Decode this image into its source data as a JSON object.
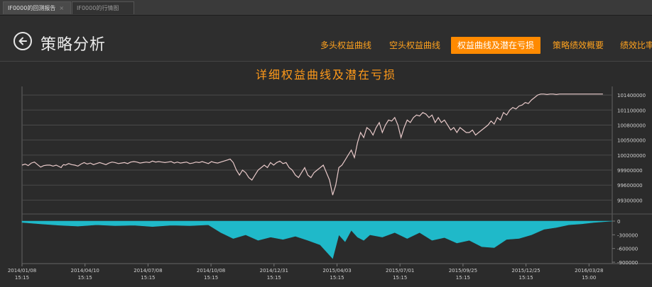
{
  "tabs": [
    {
      "label": "IF0000的回测报告",
      "active": true,
      "close": "×"
    },
    {
      "label": "IF0000的行情图",
      "active": false
    }
  ],
  "header": {
    "back_icon": "arrow-left-icon",
    "title": "策略分析",
    "nav": [
      {
        "label": "多头权益曲线",
        "active": false
      },
      {
        "label": "空头权益曲线",
        "active": false
      },
      {
        "label": "权益曲线及潜在亏损",
        "active": true
      },
      {
        "label": "策略绩效概要",
        "active": false
      },
      {
        "label": "绩效比率",
        "active": false
      }
    ]
  },
  "colors": {
    "accent": "#ff8a00",
    "line": "#e8c9c9",
    "drawdown": "#1fb9c9",
    "background": "#2b2b2b"
  },
  "chart_data": {
    "type": "area",
    "title": "详细权益曲线及潜在亏损",
    "x_ticks": [
      {
        "date": "2014/01/08",
        "time": "15:15"
      },
      {
        "date": "2014/04/10",
        "time": "15:15"
      },
      {
        "date": "2014/07/08",
        "time": "15:15"
      },
      {
        "date": "2014/10/08",
        "time": "15:15"
      },
      {
        "date": "2014/12/31",
        "time": "15:15"
      },
      {
        "date": "2015/04/03",
        "time": "15:15"
      },
      {
        "date": "2015/07/01",
        "time": "15:15"
      },
      {
        "date": "2015/09/25",
        "time": "15:15"
      },
      {
        "date": "2015/12/25",
        "time": "15:15"
      },
      {
        "date": "2016/03/28",
        "time": "15:00"
      }
    ],
    "equity": {
      "name": "权益",
      "y_ticks": [
        101400000,
        101100000,
        100800000,
        100500000,
        100200000,
        99900000,
        99600000,
        99300000
      ],
      "ylim": [
        99150000,
        101500000
      ],
      "x": [
        0,
        0.05,
        0.1,
        0.15,
        0.2,
        0.25,
        0.3,
        0.35,
        0.4,
        0.45,
        0.5,
        0.55,
        0.6,
        0.63,
        0.65,
        0.67,
        0.7,
        0.75,
        0.8,
        0.85,
        0.9,
        0.95,
        1.0,
        1.05,
        1.1,
        1.15,
        1.2,
        1.25,
        1.3,
        1.35,
        1.4,
        1.45,
        1.5,
        1.55,
        1.6,
        1.65,
        1.7,
        1.75,
        1.8,
        1.85,
        1.9,
        1.95,
        2.0,
        2.05,
        2.1,
        2.15,
        2.2,
        2.25,
        2.3,
        2.35,
        2.4,
        2.45,
        2.5,
        2.55,
        2.6,
        2.65,
        2.7,
        2.75,
        2.8,
        2.85,
        2.9,
        2.95,
        3.0,
        3.05,
        3.1,
        3.15,
        3.2,
        3.25,
        3.3,
        3.35,
        3.4,
        3.45,
        3.5,
        3.55,
        3.6,
        3.65,
        3.7,
        3.75,
        3.8,
        3.85,
        3.9,
        3.95,
        4.0,
        4.05,
        4.1,
        4.15,
        4.2,
        4.25,
        4.3,
        4.35,
        4.4,
        4.45,
        4.5,
        4.55,
        4.6,
        4.65,
        4.7,
        4.75,
        4.8,
        4.85,
        4.9,
        4.95,
        5.0,
        5.05,
        5.1,
        5.15,
        5.2,
        5.25,
        5.3,
        5.35,
        5.4,
        5.45,
        5.5,
        5.55,
        5.6,
        5.65,
        5.7,
        5.75,
        5.8,
        5.85,
        5.9,
        5.95,
        6.0,
        6.05,
        6.1,
        6.15,
        6.2,
        6.25,
        6.3,
        6.35,
        6.4,
        6.45,
        6.5,
        6.55,
        6.6,
        6.65,
        6.7,
        6.75,
        6.8,
        6.85,
        6.9,
        6.95,
        7.0,
        7.05,
        7.1,
        7.15,
        7.2,
        7.25,
        7.3,
        7.35,
        7.4,
        7.45,
        7.5,
        7.55,
        7.6,
        7.65,
        7.7,
        7.75,
        7.8,
        7.85,
        7.9,
        7.95,
        8.0,
        8.05,
        8.1,
        8.15,
        8.2,
        8.25,
        8.3,
        8.35,
        8.4,
        8.45,
        8.5,
        8.55,
        8.6,
        8.65,
        8.7,
        8.75,
        8.8,
        8.85,
        8.9,
        8.95,
        9.0,
        9.05,
        9.1,
        9.15,
        9.2,
        9.25,
        9.3,
        9.35,
        9.4,
        9.45,
        9.5
      ],
      "y": [
        100000000,
        100020000,
        99990000,
        100040000,
        100060000,
        100010000,
        99960000,
        99990000,
        100000000,
        100000000,
        99980000,
        100000000,
        99970000,
        99950000,
        99990000,
        100010000,
        100000000,
        100030000,
        100010000,
        100000000,
        99980000,
        100020000,
        100050000,
        100020000,
        100040000,
        100010000,
        100030000,
        100050000,
        100030000,
        100010000,
        100040000,
        100060000,
        100050000,
        100030000,
        100040000,
        100050000,
        100030000,
        100060000,
        100070000,
        100060000,
        100040000,
        100050000,
        100060000,
        100050000,
        100080000,
        100060000,
        100070000,
        100060000,
        100050000,
        100060000,
        100070000,
        100040000,
        100060000,
        100040000,
        100050000,
        100060000,
        100030000,
        100040000,
        100060000,
        100050000,
        100070000,
        100050000,
        100030000,
        100070000,
        100050000,
        100040000,
        100060000,
        100080000,
        100100000,
        100120000,
        100050000,
        99900000,
        99800000,
        99900000,
        99850000,
        99750000,
        99700000,
        99800000,
        99900000,
        99950000,
        100000000,
        99950000,
        100050000,
        100000000,
        100050000,
        100080000,
        100030000,
        100050000,
        99950000,
        99900000,
        99800000,
        99750000,
        99850000,
        99950000,
        99800000,
        99750000,
        99850000,
        99900000,
        99950000,
        100000000,
        99850000,
        99700000,
        99400000,
        99600000,
        99950000,
        100000000,
        100100000,
        100200000,
        100300000,
        100150000,
        100450000,
        100650000,
        100550000,
        100750000,
        100700000,
        100600000,
        100750000,
        100850000,
        100650000,
        100800000,
        100900000,
        100880000,
        100950000,
        100800000,
        100550000,
        100750000,
        100900000,
        100850000,
        100950000,
        101000000,
        100980000,
        101050000,
        101020000,
        100950000,
        101000000,
        100850000,
        100950000,
        100850000,
        100900000,
        100800000,
        100700000,
        100750000,
        100650000,
        100750000,
        100700000,
        100650000,
        100650000,
        100700000,
        100600000,
        100650000,
        100700000,
        100750000,
        100800000,
        100880000,
        100820000,
        100950000,
        100900000,
        101050000,
        101000000,
        101100000,
        101150000,
        101120000,
        101180000,
        101200000,
        101250000,
        101230000,
        101300000,
        101350000,
        101400000,
        101420000,
        101420000,
        101410000,
        101420000,
        101420000,
        101410000,
        101420000,
        101420000,
        101420000,
        101420000,
        101420000,
        101420000,
        101420000,
        101420000,
        101420000,
        101420000,
        101420000,
        101420000,
        101420000,
        101420000,
        101420000
      ]
    },
    "drawdown": {
      "name": "潜在亏损",
      "y_ticks": [
        0,
        -300000,
        -600000,
        -900000
      ],
      "ylim": [
        -900000,
        0
      ],
      "x": [
        0,
        0.3,
        0.6,
        0.9,
        1.2,
        1.5,
        1.8,
        2.1,
        2.4,
        2.7,
        3.0,
        3.2,
        3.4,
        3.6,
        3.8,
        4.0,
        4.2,
        4.4,
        4.6,
        4.8,
        5.0,
        5.1,
        5.2,
        5.3,
        5.4,
        5.5,
        5.6,
        5.8,
        6.0,
        6.2,
        6.4,
        6.6,
        6.8,
        7.0,
        7.2,
        7.4,
        7.6,
        7.8,
        8.0,
        8.2,
        8.4,
        8.6,
        8.8,
        9.0,
        9.2,
        9.5
      ],
      "y": [
        -30000,
        -60000,
        -90000,
        -110000,
        -80000,
        -100000,
        -90000,
        -120000,
        -90000,
        -100000,
        -80000,
        -250000,
        -380000,
        -300000,
        -420000,
        -350000,
        -400000,
        -330000,
        -420000,
        -520000,
        -820000,
        -300000,
        -450000,
        -200000,
        -350000,
        -420000,
        -300000,
        -350000,
        -250000,
        -380000,
        -250000,
        -420000,
        -360000,
        -480000,
        -420000,
        -560000,
        -580000,
        -400000,
        -380000,
        -300000,
        -180000,
        -140000,
        -80000,
        -60000,
        -30000,
        0
      ]
    }
  }
}
